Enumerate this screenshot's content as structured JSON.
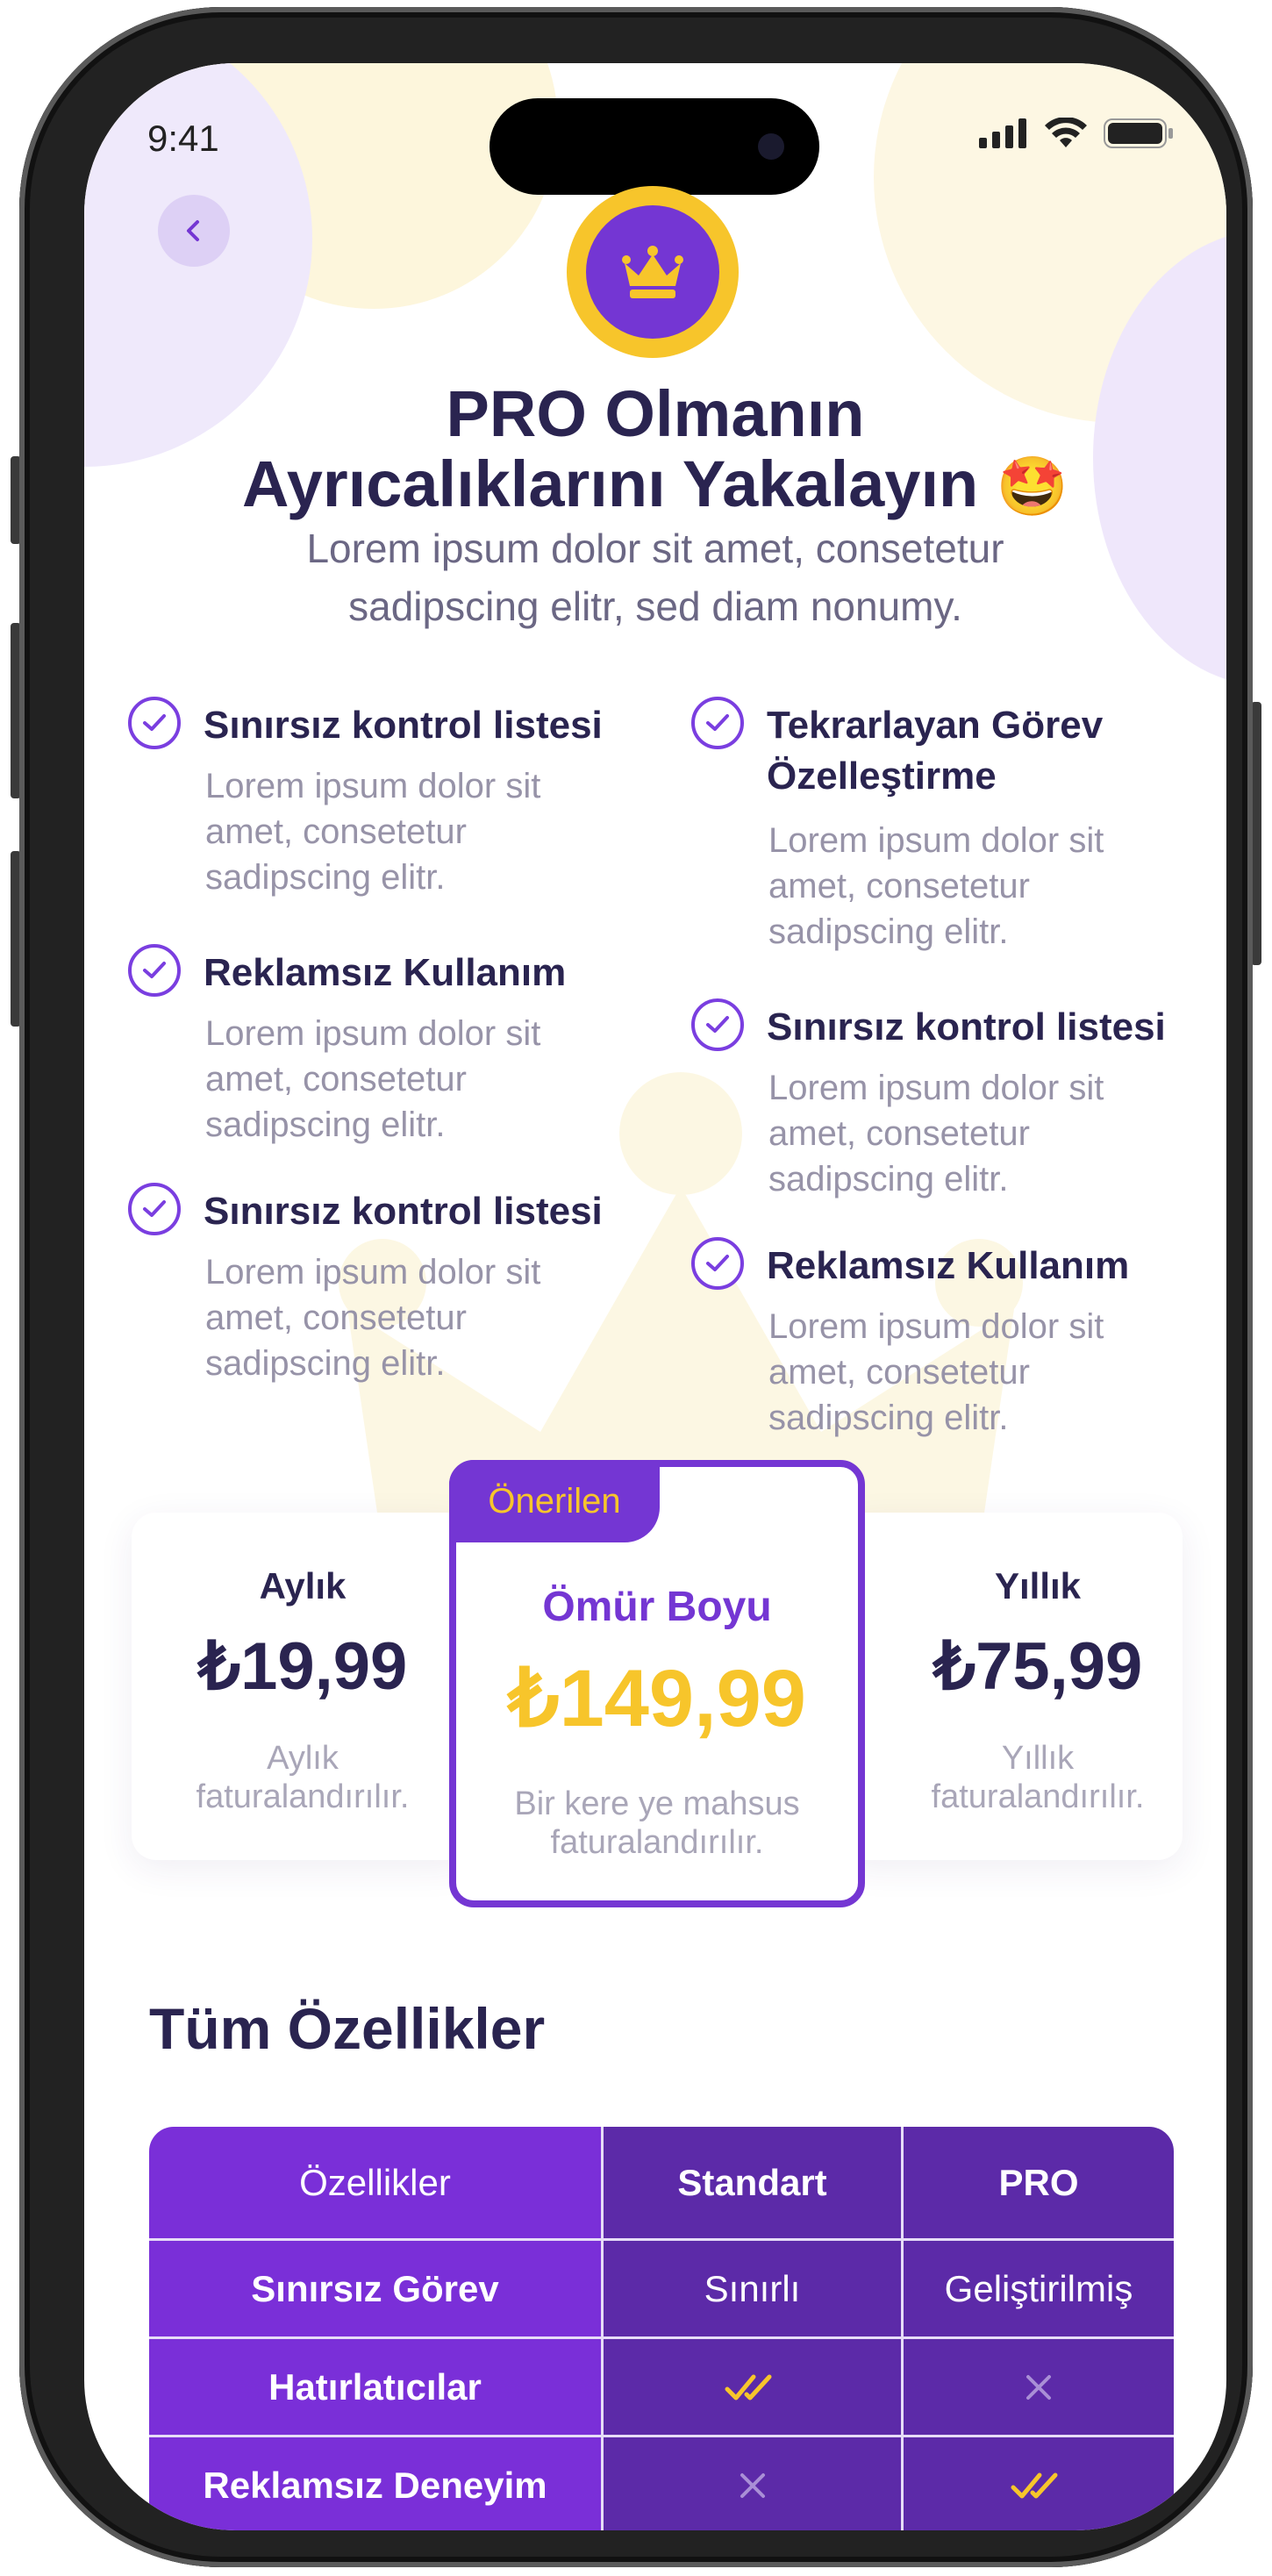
{
  "status_bar": {
    "time": "9:41"
  },
  "header": {
    "title_line1": "PRO Olmanın",
    "title_line2": "Ayrıcalıklarını Yakalayın",
    "title_emoji": "🤩",
    "subtitle": "Lorem ipsum dolor sit amet, consetetur sadipscing elitr, sed diam nonumy."
  },
  "features": {
    "left": [
      {
        "title": "Sınırsız kontrol listesi",
        "desc": "Lorem ipsum dolor sit amet, consetetur sadipscing elitr."
      },
      {
        "title": "Reklamsız Kullanım",
        "desc": "Lorem ipsum dolor sit amet, consetetur sadipscing elitr."
      },
      {
        "title": "Sınırsız kontrol listesi",
        "desc": "Lorem ipsum dolor sit amet, consetetur sadipscing elitr."
      }
    ],
    "right": [
      {
        "title": "Tekrarlayan Görev Özelleştirme",
        "desc": "Lorem ipsum dolor sit amet, consetetur sadipscing elitr."
      },
      {
        "title": "Sınırsız kontrol listesi",
        "desc": "Lorem ipsum dolor sit amet, consetetur sadipscing elitr."
      },
      {
        "title": "Reklamsız Kullanım",
        "desc": "Lorem ipsum dolor sit amet, consetetur sadipscing elitr."
      }
    ]
  },
  "plans": {
    "monthly": {
      "name": "Aylık",
      "price": "₺19,99",
      "note_line1": "Aylık",
      "note_line2": "faturalandırılır."
    },
    "lifetime": {
      "badge": "Önerilen",
      "name": "Ömür Boyu",
      "price": "₺149,99",
      "note_line1": "Bir kere ye mahsus",
      "note_line2": "faturalandırılır."
    },
    "yearly": {
      "name": "Yıllık",
      "price": "₺75,99",
      "note_line1": "Yıllık",
      "note_line2": "faturalandırılır."
    }
  },
  "all_features": {
    "title": "Tüm Özellikler",
    "columns": [
      "Özellikler",
      "Standart",
      "PRO"
    ],
    "rows": [
      {
        "feature": "Sınırsız Görev",
        "standard": "Sınırlı",
        "pro": "Geliştirilmiş"
      },
      {
        "feature": "Hatırlatıcılar",
        "standard_icon": "double-check-icon",
        "pro_icon": "cross-icon"
      },
      {
        "feature": "Reklamsız Deneyim",
        "standard_icon": "cross-icon",
        "pro_icon": "double-check-icon"
      }
    ]
  },
  "colors": {
    "primary": "#7436d3",
    "accent": "#f7c52b",
    "text_dark": "#2a2450",
    "text_muted": "#9793a8"
  }
}
